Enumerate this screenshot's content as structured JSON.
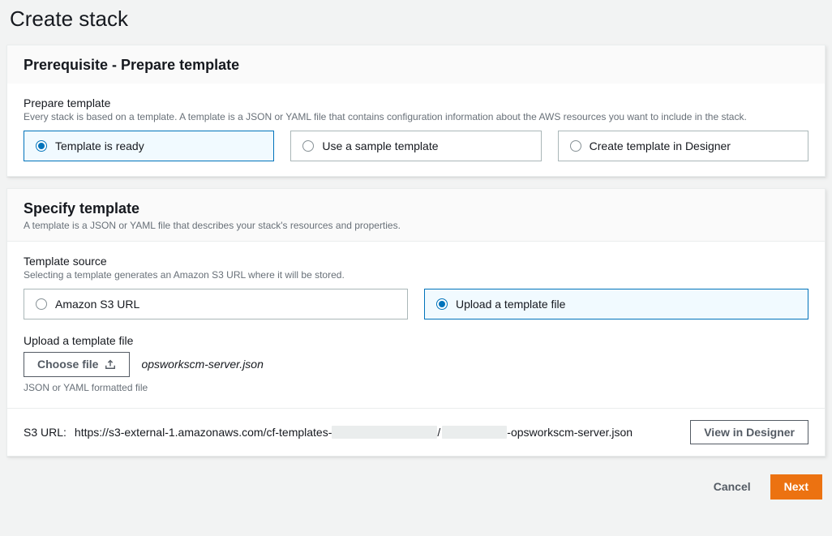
{
  "page": {
    "title": "Create stack"
  },
  "panel1": {
    "title": "Prerequisite - Prepare template",
    "section_label": "Prepare template",
    "section_desc": "Every stack is based on a template. A template is a JSON or YAML file that contains configuration information about the AWS resources you want to include in the stack.",
    "options": {
      "ready": "Template is ready",
      "sample": "Use a sample template",
      "designer": "Create template in Designer"
    }
  },
  "panel2": {
    "title": "Specify template",
    "subtitle": "A template is a JSON or YAML file that describes your stack's resources and properties.",
    "source_label": "Template source",
    "source_desc": "Selecting a template generates an Amazon S3 URL where it will be stored.",
    "options": {
      "s3": "Amazon S3 URL",
      "upload": "Upload a template file"
    },
    "upload_label": "Upload a template file",
    "choose_file": "Choose file",
    "filename": "opsworkscm-server.json",
    "file_hint": "JSON or YAML formatted file",
    "s3_label": "S3 URL:",
    "s3_prefix": "https://s3-external-1.amazonaws.com/cf-templates-",
    "s3_mid": "/",
    "s3_suffix": "-opsworkscm-server.json",
    "view_designer": "View in Designer"
  },
  "footer": {
    "cancel": "Cancel",
    "next": "Next"
  }
}
